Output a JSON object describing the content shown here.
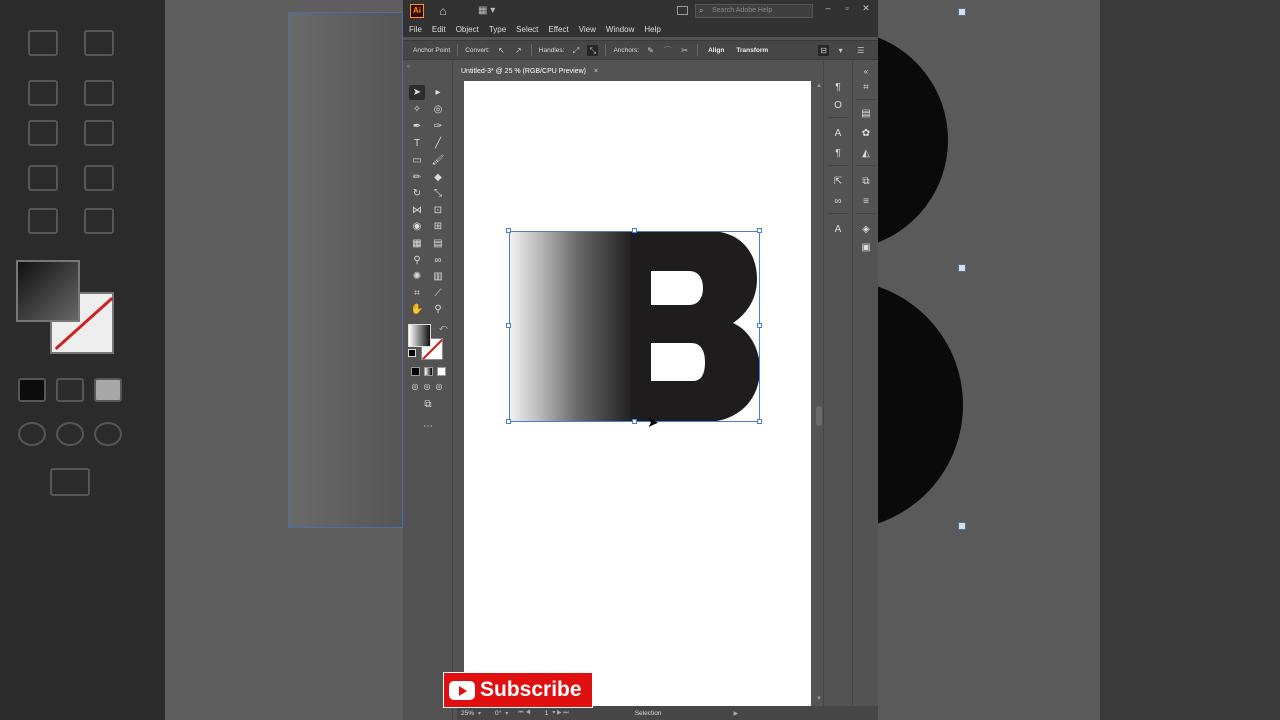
{
  "app": {
    "logo": "Ai",
    "search_placeholder": "Search Adobe Help",
    "menu": [
      "File",
      "Edit",
      "Object",
      "Type",
      "Select",
      "Effect",
      "View",
      "Window",
      "Help"
    ]
  },
  "control_bar": {
    "mode_label": "Anchor Point",
    "convert_label": "Convert:",
    "handles_label": "Handles:",
    "anchors_label": "Anchors:",
    "align_label": "Align",
    "transform_label": "Transform"
  },
  "document": {
    "tab_title": "Untitled-3* @ 25 % (RGB/CPU Preview)",
    "close_glyph": "×"
  },
  "status_bar": {
    "zoom": "25%",
    "rotation": "0°",
    "artboard_number": "1",
    "tool_name": "Selection"
  },
  "overlay": {
    "subscribe_label": "Subscribe"
  },
  "artwork": {
    "letter": "B",
    "fill_color": "#1e1c1c",
    "gradient_start": "#f5f5f5",
    "gradient_end": "#1e1e1e",
    "selection_color": "#4a7fd0"
  },
  "colors": {
    "app_bg": "#535353",
    "chrome_bg": "#323232",
    "subscribe_red": "#e01010"
  }
}
